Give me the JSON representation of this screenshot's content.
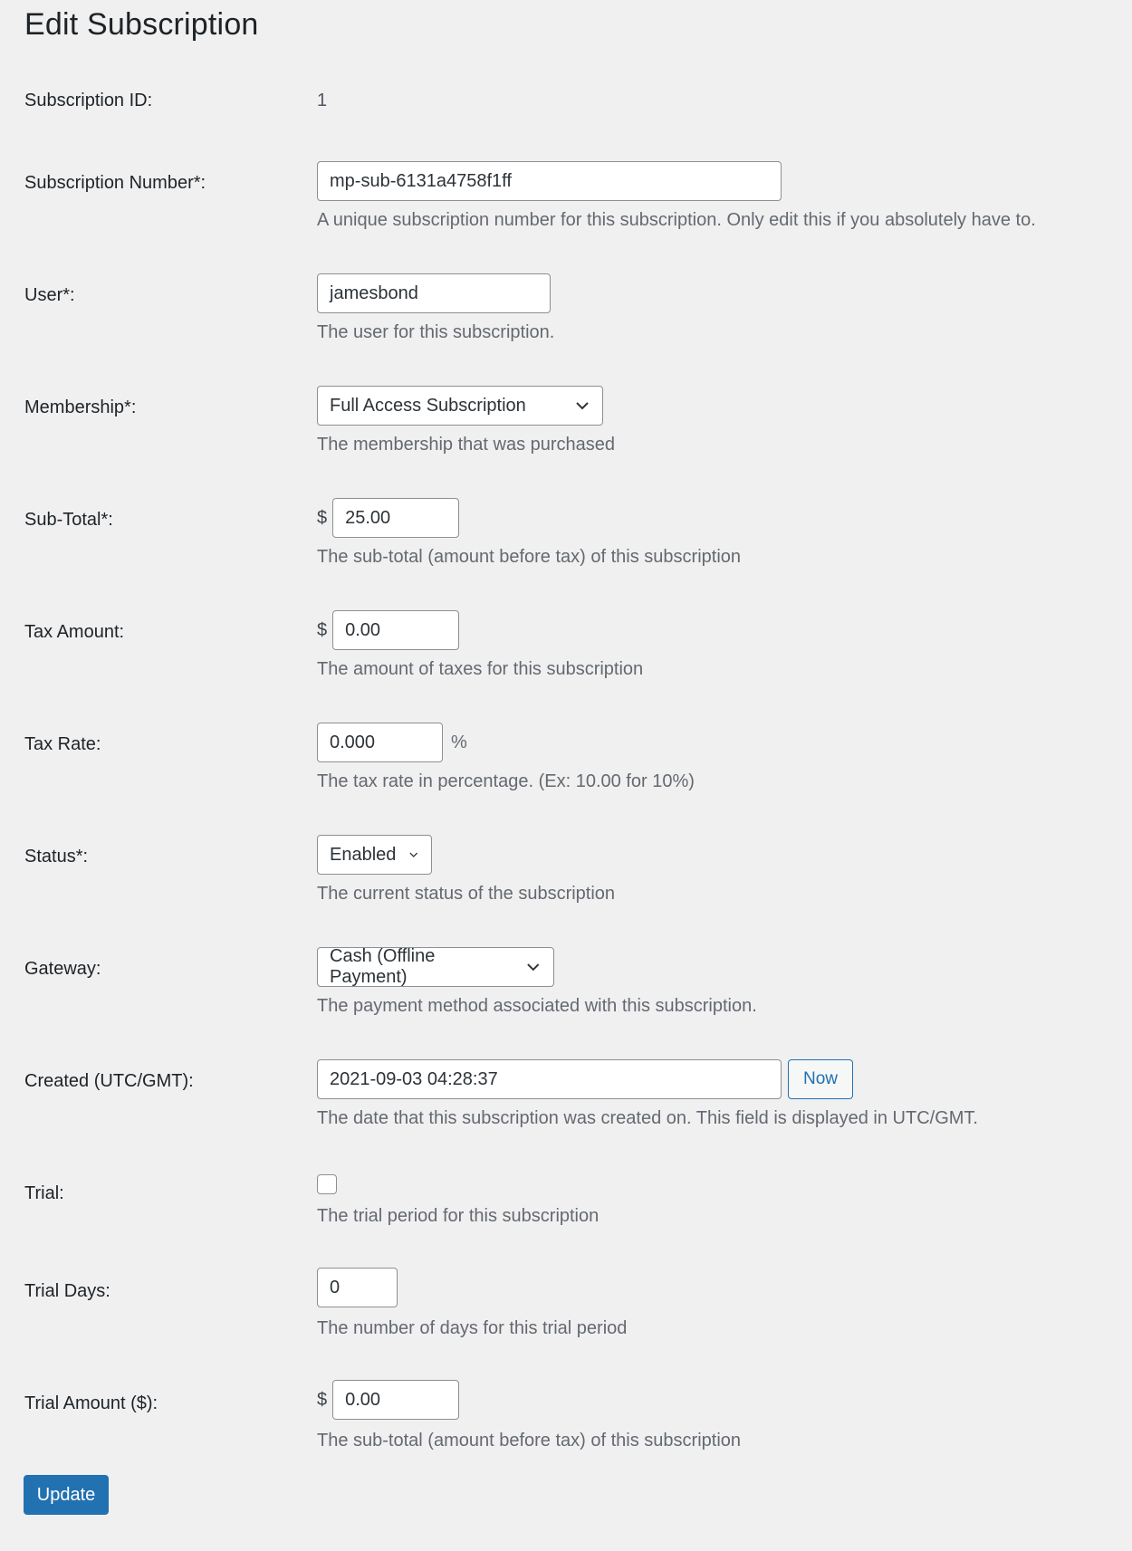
{
  "page": {
    "title": "Edit Subscription"
  },
  "fields": {
    "subscription_id": {
      "label": "Subscription ID:",
      "value": "1"
    },
    "subscription_number": {
      "label": "Subscription Number*:",
      "value": "mp-sub-6131a4758f1ff",
      "description": "A unique subscription number for this subscription. Only edit this if you absolutely have to."
    },
    "user": {
      "label": "User*:",
      "value": "jamesbond",
      "description": "The user for this subscription."
    },
    "membership": {
      "label": "Membership*:",
      "selected": "Full Access Subscription",
      "description": "The membership that was purchased"
    },
    "sub_total": {
      "label": "Sub-Total*:",
      "prefix": "$",
      "value": "25.00",
      "description": "The sub-total (amount before tax) of this subscription"
    },
    "tax_amount": {
      "label": "Tax Amount:",
      "prefix": "$",
      "value": "0.00",
      "description": "The amount of taxes for this subscription"
    },
    "tax_rate": {
      "label": "Tax Rate:",
      "value": "0.000",
      "suffix": "%",
      "description": "The tax rate in percentage. (Ex: 10.00 for 10%)"
    },
    "status": {
      "label": "Status*:",
      "selected": "Enabled",
      "description": "The current status of the subscription"
    },
    "gateway": {
      "label": "Gateway:",
      "selected": "Cash (Offline Payment)",
      "description": "The payment method associated with this subscription."
    },
    "created": {
      "label": "Created (UTC/GMT):",
      "value": "2021-09-03 04:28:37",
      "now_button": "Now",
      "description": "The date that this subscription was created on. This field is displayed in UTC/GMT."
    },
    "trial": {
      "label": "Trial:",
      "checked": false,
      "description": "The trial period for this subscription"
    },
    "trial_days": {
      "label": "Trial Days:",
      "value": "0",
      "description": "The number of days for this trial period"
    },
    "trial_amount": {
      "label": "Trial Amount ($):",
      "prefix": "$",
      "value": "0.00",
      "description": "The sub-total (amount before tax) of this subscription"
    }
  },
  "actions": {
    "update_label": "Update"
  },
  "colors": {
    "background": "#f0f0f1",
    "primary": "#2271b1",
    "description_text": "#646970"
  }
}
